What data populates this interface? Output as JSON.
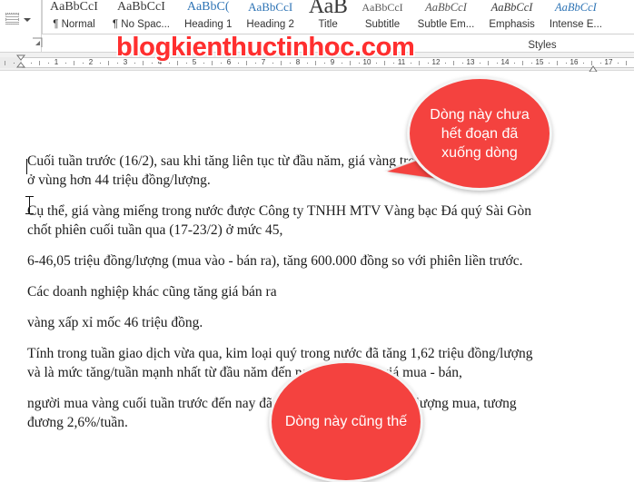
{
  "ribbon": {
    "paragraph_mark_icon": "paragraph-dropdown-icon",
    "styles_group_label": "Styles",
    "styles_dialog_launcher": "styles-dialog-launcher-icon",
    "styles": [
      {
        "preview": "AaBbCcI",
        "label": "¶ Normal"
      },
      {
        "preview": "AaBbCcI",
        "label": "¶ No Spac..."
      },
      {
        "preview": "AaBbC(",
        "label": "Heading 1"
      },
      {
        "preview": "AaBbCcI",
        "label": "Heading 2"
      },
      {
        "preview": "AaB",
        "label": "Title"
      },
      {
        "preview": "AaBbCcI",
        "label": "Subtitle"
      },
      {
        "preview": "AaBbCcI",
        "label": "Subtle Em..."
      },
      {
        "preview": "AaBbCcI",
        "label": "Emphasis"
      },
      {
        "preview": "AaBbCcI",
        "label": "Intense E..."
      }
    ]
  },
  "ruler": {
    "numbers": [
      1,
      2,
      3,
      4,
      5,
      6,
      7,
      8,
      9,
      10,
      11,
      12,
      13,
      14,
      15,
      16,
      17
    ],
    "left_indent_marker": "left-indent-marker",
    "right_indent_marker": "right-indent-marker"
  },
  "watermark": {
    "text": "blogkienthuctinhoc.com",
    "color": "#ff2f2f"
  },
  "document": {
    "paragraphs": [
      {
        "lines": [
          "Cuối tuần trước (16/2), sau khi tăng liên tục từ đầu năm, giá vàng trong nước giao dịch",
          "ở vùng hơn 44 triệu đồng/lượng."
        ]
      },
      {
        "lines": [
          "Cụ thể, giá vàng miếng trong nước được Công ty TNHH MTV Vàng bạc Đá quý Sài Gòn",
          "chốt phiên cuối tuần qua (17-23/2) ở mức 45,"
        ]
      },
      {
        "lines": [
          "6-46,05 triệu đồng/lượng (mua vào - bán ra), tăng 600.000 đồng so với phiên liền trước."
        ]
      },
      {
        "lines": [
          "Các doanh nghiệp khác cũng tăng giá bán ra"
        ]
      },
      {
        "lines": [
          "vàng xấp xỉ mốc 46 triệu đồng."
        ]
      },
      {
        "lines": [
          "Tính trong tuần giao dịch vừa qua, kim loại quý trong nước đã tăng 1,62 triệu đồng/lượng",
          "và là mức tăng/tuần mạnh nhất từ đầu năm đến nay. Chên lệch giá mua - bán,"
        ]
      },
      {
        "lines": [
          "người mua vàng cuối tuần trước đến nay đã lãi hơn 1 triệu đồng mỗi lượng mua, tương",
          "đương 2,6%/tuần."
        ]
      }
    ]
  },
  "callouts": [
    {
      "id": "callout-1",
      "text": "Dòng này chưa hết đoạn đã xuống dòng",
      "color": "#f4423f"
    },
    {
      "id": "callout-2",
      "text": "Dòng này cũng thế",
      "color": "#f4423f"
    }
  ]
}
